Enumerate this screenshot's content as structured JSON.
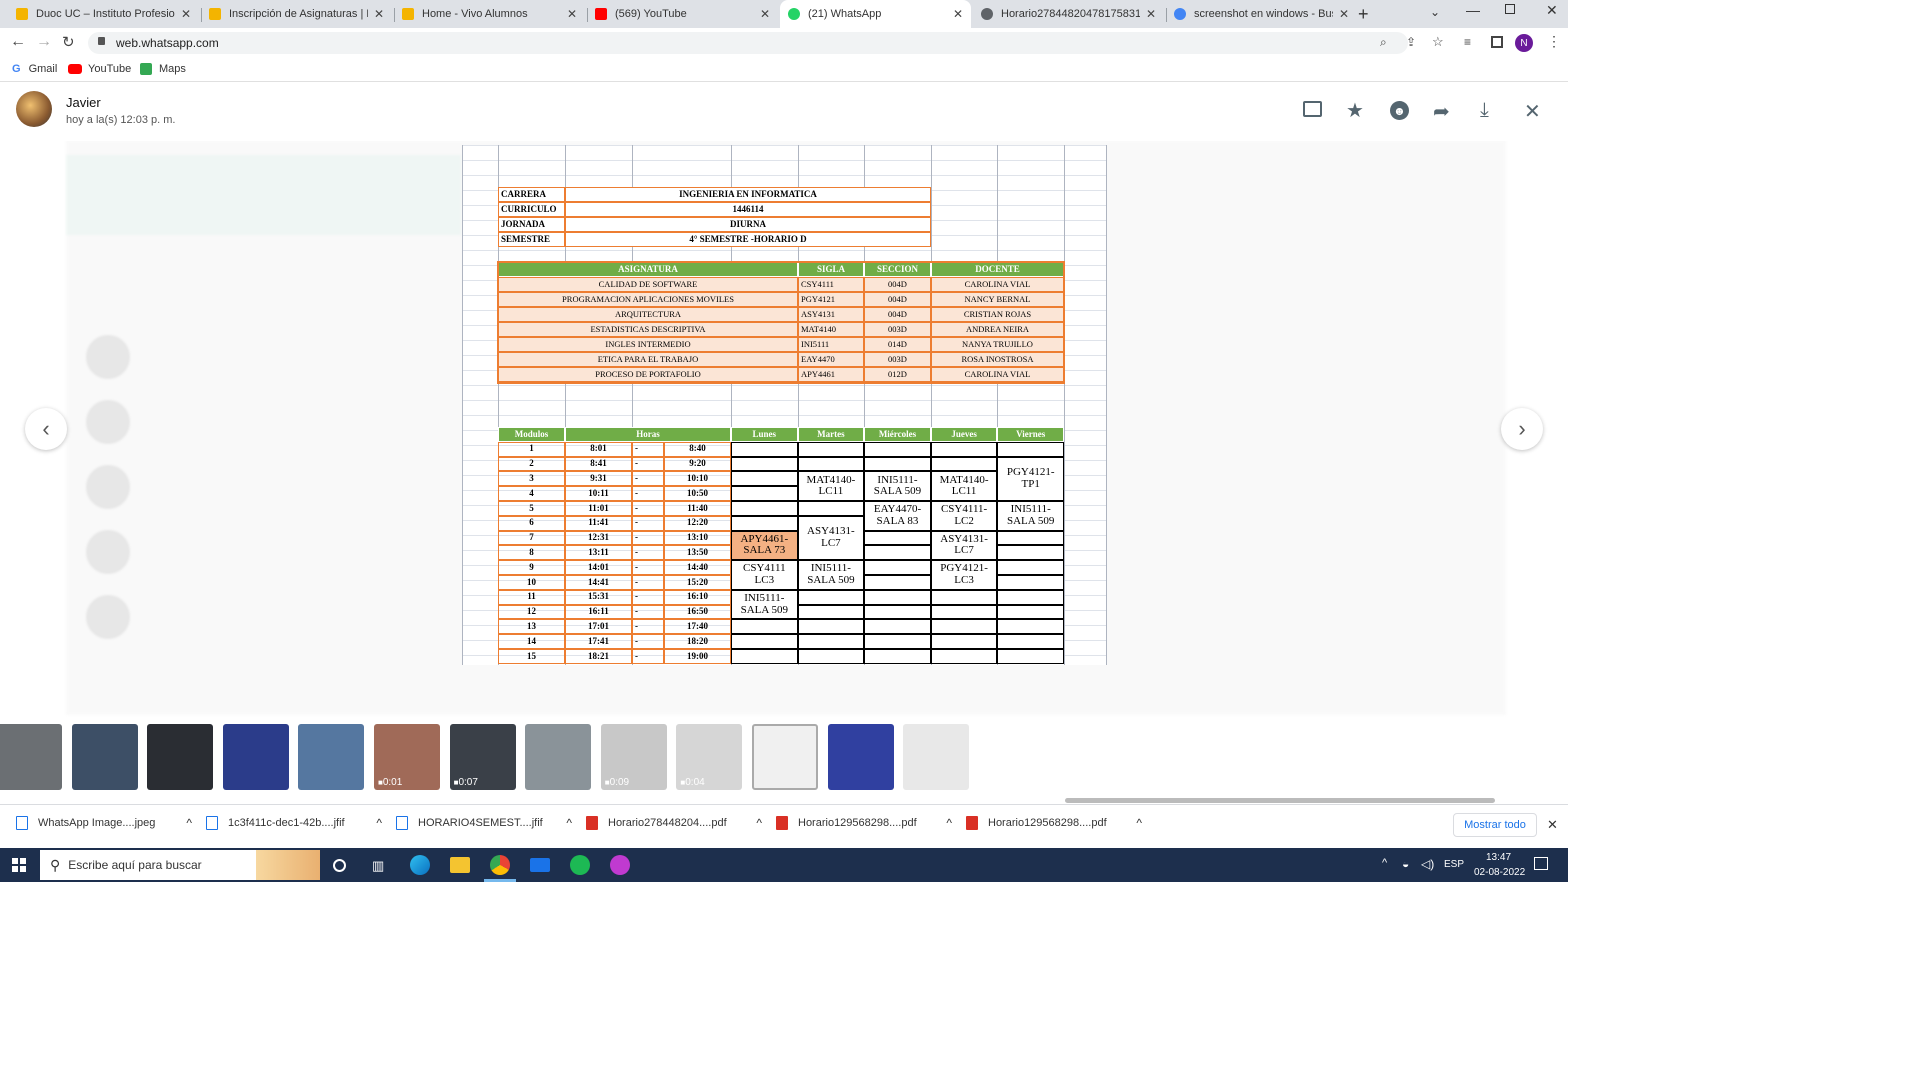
{
  "browser": {
    "tabs": [
      {
        "title": "Duoc UC – Instituto Profesional",
        "favicon": "duoc-icon",
        "color": "#f4b400"
      },
      {
        "title": "Inscripción de Asignaturas | Duo",
        "favicon": "duoc-icon",
        "color": "#f4b400"
      },
      {
        "title": "Home - Vivo Alumnos",
        "favicon": "duoc-icon",
        "color": "#f4b400"
      },
      {
        "title": "(569) YouTube",
        "favicon": "youtube-icon",
        "color": "#ff0000"
      },
      {
        "title": "(21) WhatsApp",
        "favicon": "whatsapp-icon",
        "color": "#25d366"
      },
      {
        "title": "Horario278448204781758317.p",
        "favicon": "globe-icon",
        "color": "#5f6368"
      },
      {
        "title": "screenshot en windows - Buscar",
        "favicon": "google-icon",
        "color": "#4285f4"
      }
    ],
    "url": "web.whatsapp.com",
    "bookmarks": [
      {
        "label": "Gmail",
        "icon": "google-icon"
      },
      {
        "label": "YouTube",
        "icon": "youtube-icon"
      },
      {
        "label": "Maps",
        "icon": "maps-icon"
      }
    ],
    "profile_initial": "N"
  },
  "viewer": {
    "sender": "Javier",
    "timestamp": "hoy a la(s) 12:03 p. m."
  },
  "sheet": {
    "info": [
      {
        "label": "CARRERA",
        "value": "INGENIERIA  EN INFORMATICA"
      },
      {
        "label": "CURRICULO",
        "value": "1446114"
      },
      {
        "label": "JORNADA",
        "value": "DIURNA"
      },
      {
        "label": "SEMESTRE",
        "value": "4° SEMESTRE -HORARIO D"
      }
    ],
    "courses_header": [
      "ASIGNATURA",
      "SIGLA",
      "SECCION",
      "DOCENTE"
    ],
    "courses": [
      [
        "CALIDAD DE SOFTWARE",
        "CSY4111",
        "004D",
        "CAROLINA VIAL"
      ],
      [
        "PROGRAMACION APLICACIONES MOVILES",
        "PGY4121",
        "004D",
        "NANCY BERNAL"
      ],
      [
        "ARQUITECTURA",
        "ASY4131",
        "004D",
        "CRISTIAN ROJAS"
      ],
      [
        "ESTADISTICAS DESCRIPTIVA",
        "MAT4140",
        "003D",
        "ANDREA NEIRA"
      ],
      [
        "INGLES INTERMEDIO",
        "INI5111",
        "014D",
        "NANYA TRUJILLO"
      ],
      [
        "ETICA PARA EL TRABAJO",
        "EAY4470",
        "003D",
        "ROSA INOSTROSA"
      ],
      [
        "PROCESO DE PORTAFOLIO",
        "APY4461",
        "012D",
        "CAROLINA VIAL"
      ]
    ],
    "schedule_header": [
      "Modulos",
      "Horas",
      "Lunes",
      "Martes",
      "Miércoles",
      "Jueves",
      "Viernes"
    ],
    "modules": [
      [
        "1",
        "8:01",
        "-",
        "8:40"
      ],
      [
        "2",
        "8:41",
        "-",
        "9:20"
      ],
      [
        "3",
        "9:31",
        "-",
        "10:10"
      ],
      [
        "4",
        "10:11",
        "-",
        "10:50"
      ],
      [
        "5",
        "11:01",
        "-",
        "11:40"
      ],
      [
        "6",
        "11:41",
        "-",
        "12:20"
      ],
      [
        "7",
        "12:31",
        "-",
        "13:10"
      ],
      [
        "8",
        "13:11",
        "-",
        "13:50"
      ],
      [
        "9",
        "14:01",
        "-",
        "14:40"
      ],
      [
        "10",
        "14:41",
        "-",
        "15:20"
      ],
      [
        "11",
        "15:31",
        "-",
        "16:10"
      ],
      [
        "12",
        "16:11",
        "-",
        "16:50"
      ],
      [
        "13",
        "17:01",
        "-",
        "17:40"
      ],
      [
        "14",
        "17:41",
        "-",
        "18:20"
      ],
      [
        "15",
        "18:21",
        "-",
        "19:00"
      ]
    ],
    "blocks": [
      {
        "day": 1,
        "start": 2,
        "span": 2,
        "text": "MAT4140-\nLC11"
      },
      {
        "day": 2,
        "start": 2,
        "span": 2,
        "text": "INI5111-\nSALA 509"
      },
      {
        "day": 3,
        "start": 2,
        "span": 2,
        "text": "MAT4140-\nLC11"
      },
      {
        "day": 4,
        "start": 1,
        "span": 3,
        "text": "PGY4121-\nTP1"
      },
      {
        "day": 2,
        "start": 4,
        "span": 2,
        "text": "EAY4470-\nSALA  83"
      },
      {
        "day": 3,
        "start": 4,
        "span": 2,
        "text": "CSY4111-\nLC2"
      },
      {
        "day": 4,
        "start": 4,
        "span": 2,
        "text": "INI5111-\nSALA 509"
      },
      {
        "day": 1,
        "start": 5,
        "span": 3,
        "text": "ASY4131-\nLC7"
      },
      {
        "day": 0,
        "start": 6,
        "span": 2,
        "text": "APY4461-\nSALA 73",
        "highlight": true
      },
      {
        "day": 3,
        "start": 6,
        "span": 2,
        "text": "ASY4131-\nLC7"
      },
      {
        "day": 0,
        "start": 8,
        "span": 2,
        "text": "CSY4111\nLC3"
      },
      {
        "day": 1,
        "start": 8,
        "span": 2,
        "text": "INI5111-\nSALA 509"
      },
      {
        "day": 3,
        "start": 8,
        "span": 2,
        "text": "PGY4121-\nLC3"
      },
      {
        "day": 0,
        "start": 10,
        "span": 2,
        "text": "INI5111-\nSALA 509"
      }
    ]
  },
  "thumbnails": [
    {
      "color": "#6b6f73",
      "duration": ""
    },
    {
      "color": "#3d4f66",
      "duration": ""
    },
    {
      "color": "#2a2d33",
      "duration": ""
    },
    {
      "color": "#2b3c8a",
      "duration": ""
    },
    {
      "color": "#5577a0",
      "duration": ""
    },
    {
      "color": "#a06a58",
      "duration": "0:01"
    },
    {
      "color": "#3a4048",
      "duration": "0:07"
    },
    {
      "color": "#8a9399",
      "duration": ""
    },
    {
      "color": "#c8c8c8",
      "duration": "0:09"
    },
    {
      "color": "#d6d6d6",
      "duration": "0:04"
    },
    {
      "color": "#f0f0f0",
      "duration": ""
    },
    {
      "color": "#3040a0",
      "duration": ""
    },
    {
      "color": "#e8e8e8",
      "duration": ""
    }
  ],
  "downloads": [
    {
      "name": "WhatsApp Image....jpeg",
      "icon": "image-file-icon"
    },
    {
      "name": "1c3f411c-dec1-42b....jfif",
      "icon": "image-file-icon"
    },
    {
      "name": "HORARIO4SEMEST....jfif",
      "icon": "image-file-icon"
    },
    {
      "name": "Horario278448204....pdf",
      "icon": "pdf-file-icon"
    },
    {
      "name": "Horario129568298....pdf",
      "icon": "pdf-file-icon"
    },
    {
      "name": "Horario129568298....pdf",
      "icon": "pdf-file-icon"
    }
  ],
  "downloads_show_all": "Mostrar todo",
  "taskbar": {
    "search_placeholder": "Escribe aquí para buscar",
    "lang": "ESP",
    "time": "13:47",
    "date": "02-08-2022"
  },
  "colors": {
    "sheet_green": "#70ad47",
    "sheet_orange": "#ed7d31",
    "sheet_peach": "#fbe5d6",
    "highlight": "#f4b183"
  }
}
